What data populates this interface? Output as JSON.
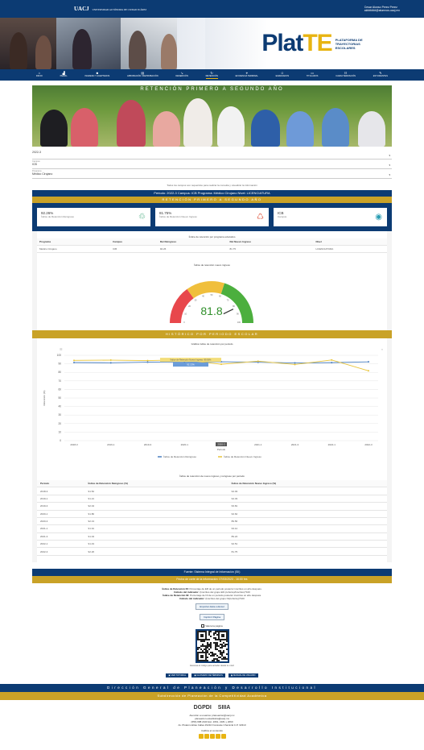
{
  "topbar": {
    "logo": "UACJ",
    "logo_sub": "UNIVERSIDAD AUTÓNOMA DE CIUDAD JUÁREZ",
    "user_name": "Cesar Alonso Perez Perez",
    "user_email": "al######@alumnos.uacj.mx"
  },
  "banner": {
    "logo_main": "Plat",
    "logo_accent": "TE",
    "logo_sub": "PLATAFORMA DE TRAYECTORIAS ESCOLARES"
  },
  "nav": [
    {
      "label": "INICIO",
      "icon": "home-icon"
    },
    {
      "label": "PERFIL",
      "icon": "chart-icon"
    },
    {
      "label": "INGRESO Y ACEPTADOS",
      "icon": "users-icon"
    },
    {
      "label": "APROBACIÓN / REPROBACIÓN",
      "icon": "book-icon"
    },
    {
      "label": "DESERCIÓN",
      "icon": "chart-down-icon"
    },
    {
      "label": "RETENCIÓN",
      "icon": "refresh-icon"
    },
    {
      "label": "EFICIENCIA TERMINAL",
      "icon": "graduation-icon"
    },
    {
      "label": "EGRESADOS",
      "icon": "user-icon"
    },
    {
      "label": "TITULADOS",
      "icon": "diploma-icon"
    },
    {
      "label": "CARACTERIZACIÓN",
      "icon": "group-icon"
    },
    {
      "label": "ESTUDIANTES",
      "icon": "student-icon"
    }
  ],
  "hero": {
    "title": "RETENCIÓN PRIMERO A SEGUNDO AÑO"
  },
  "filters": {
    "periodo_label": "",
    "periodo_value": "2022-3",
    "campus_label": "Campus",
    "campus_value": "ICB",
    "programa_label": "Programa",
    "programa_value": "Médico Cirujano"
  },
  "note": "Todos los campos son requeridos para realizar la consulta y visualizar la información",
  "filter_summary": "Periodo: 2022-3  Campus: ICB  Programa: Médico Cirujano  Nivel: LICENCIATURA",
  "section_title": "RETENCIÓN PRIMERO A SEGUNDO AÑO",
  "cards": [
    {
      "value": "92.26%",
      "label": "Índice de Retención Reingreso",
      "icon": "users-refresh-icon",
      "color": "#2a9d6a"
    },
    {
      "value": "81.75%",
      "label": "Índice de Retención Nuevo Ingreso",
      "icon": "users-new-icon",
      "color": "#e0604a"
    },
    {
      "value": "ICB",
      "label": "Campus",
      "icon": "location-icon",
      "color": "#2a9db3"
    }
  ],
  "table1": {
    "title": "Índice de retención por programa educativo",
    "headers": [
      "Programa",
      "Campus",
      "Ret Reingreso",
      "Ret Nuevo Ingreso",
      "Nivel"
    ],
    "rows": [
      [
        "Médico Cirujano",
        "ICB",
        "92.26",
        "81.75",
        "LICENCIATURA"
      ]
    ]
  },
  "gauge": {
    "title": "Índice de retención nuevo ingreso",
    "value": 81.8,
    "display": "81.8",
    "min": 0,
    "max": 100
  },
  "hist_title": "HISTÓRICO POR PERIODO ESCOLAR",
  "chart_data": {
    "type": "line",
    "title": "Gráfica índice de retención por periodo",
    "xlabel": "Periodo",
    "ylabel": "Retención (%)",
    "ylim": [
      0,
      100
    ],
    "yticks": [
      0,
      10,
      20,
      30,
      40,
      50,
      60,
      70,
      80,
      90,
      100
    ],
    "categories": [
      "2018-3",
      "2019-1",
      "2019-3",
      "2020-1",
      "2020-3",
      "2021-1",
      "2021-3",
      "2022-1",
      "2022-3"
    ],
    "series": [
      {
        "name": "Índice de Retención Reingreso",
        "color": "#4a7fc1",
        "values": [
          91.5,
          91.2,
          92.0,
          91.8,
          92.4,
          91.9,
          91.0,
          91.4,
          92.3
        ]
      },
      {
        "name": "Índice de Retención Nuevo Ingreso",
        "color": "#e8c43a",
        "values": [
          94.0,
          94.3,
          93.8,
          94.6,
          89.5,
          93.1,
          89.2,
          94.5,
          81.8
        ]
      }
    ],
    "legend": "bottom",
    "tooltip_label": "2020-3",
    "tooltip_values": [
      "Índice de Retención Nuevo Ingreso: 89.56%",
      "92.13%"
    ]
  },
  "table2": {
    "title": "Índice de retención de nuevo ingreso y reingreso por periodo",
    "headers": [
      "Periodo",
      "Índice de Retención Reingreso (%)",
      "Índice de Retención Nuevo Ingreso (%)"
    ],
    "rows": [
      [
        "2018-3",
        "91.52",
        "94.03"
      ],
      [
        "2019-1",
        "91.21",
        "94.33"
      ],
      [
        "2019-3",
        "92.04",
        "93.81"
      ],
      [
        "2020-1",
        "91.80",
        "94.62"
      ],
      [
        "2020-3",
        "92.13",
        "89.56"
      ],
      [
        "2021-1",
        "91.91",
        "93.12"
      ],
      [
        "2021-3",
        "91.04",
        "89.24"
      ],
      [
        "2022-1",
        "91.43",
        "94.51"
      ],
      [
        "2022-3",
        "92.26",
        "81.75"
      ]
    ]
  },
  "footer": {
    "source": "Fuente: Sistema Integral de Información (SII)",
    "cut_date": "Fecha de corte de la información: 07/03/2023 - 16:00 hrs"
  },
  "definitions": [
    {
      "term": "Índice de Retención RI:",
      "text": "Porcentaje de ER de un periodo posterior inscritos un año después."
    },
    {
      "term": "Cálculo del indicador:",
      "text": "(Inscritos del grupo ER (cohorte)/Inscritos)*100"
    },
    {
      "term": "Índice de Retención NI:",
      "text": "Porcentaje de NI de un periodo posterior inscritos un año después."
    },
    {
      "term": "Cálculo del indicador:",
      "text": "(Inscritos del grupo NI(cohorte))*100"
    }
  ],
  "buttons": {
    "pdf": "Exportar datos a Excel",
    "print": "Imprimir Página",
    "rating_label": "Valora la página",
    "qr_caption": "Escanea el código para acceder desde tu móvil"
  },
  "pills": [
    "VER TUTORIAL",
    "GLOSARIO DE TÉRMINOS",
    "MANUAL DE USUARIO"
  ],
  "dg1": "Dirección General de Planeación y Desarrollo Institucional",
  "dg2": "Subdirección de Planeación de la Competitividad Académica",
  "contact": {
    "line1": "Atención a usuarios: planeacion@uacj.mx",
    "line2": "planeacion.estadistica@uacj.mx",
    "line3": "(656) 688 2100 Ext. 2061, 2181 y 2060",
    "line4": "Av. Plutarco Elías Calles #1210 Fovissste Chamizal C.P. 32310",
    "rate": "Califica el contenido"
  },
  "partner_logos": [
    "DGPDI",
    "SIIIA"
  ]
}
